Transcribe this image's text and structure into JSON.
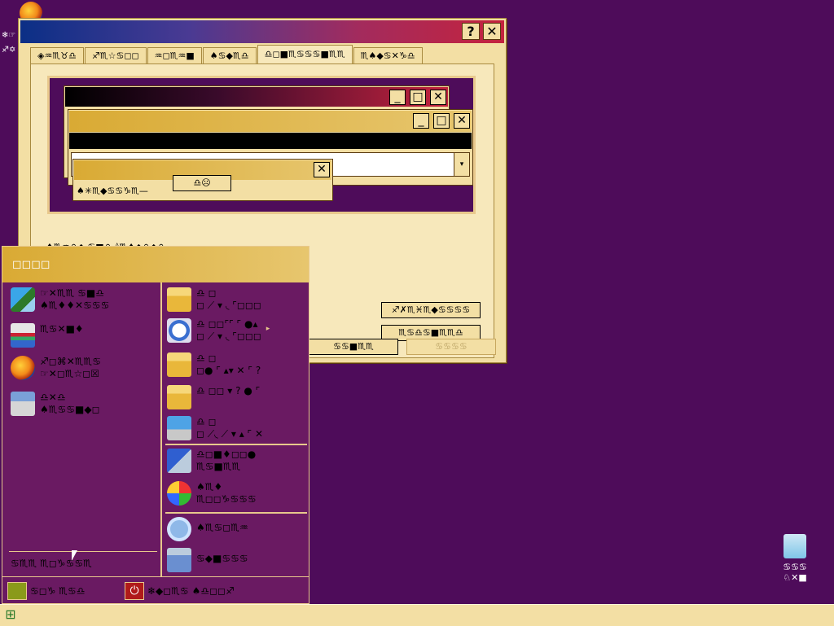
{
  "desktop": {
    "icons": [
      {
        "label": "❄☞"
      },
      {
        "label": "♐✡"
      }
    ],
    "recycle_bin": {
      "label_line1": "♋♋♋",
      "label_line2": "♘✕■"
    }
  },
  "dialog": {
    "help_glyph": "?",
    "close_glyph": "✕",
    "tabs": [
      "◈♒♏♉♎",
      "♐♏☆♋◻◻",
      "♒◻♏♒■",
      "♠♋◆♏♎",
      "♎◻■♏♋♋♋■♏♏",
      "♏♠◆♋✕♑♎"
    ],
    "active_tab": 4,
    "preview": {
      "win1_buttons": {
        "min": "_",
        "max": "□",
        "close": "✕"
      },
      "win2_buttons": {
        "min": "_",
        "max": "□",
        "close": "✕"
      },
      "msgbox": {
        "close": "✕",
        "text": "♠✳♏◆♋♋♑♏—",
        "ok_label": "♎☹"
      }
    },
    "scheme_label": "♦♏♒♎◆  ♋■♎  ◊♏♠◆♎◆♎",
    "scheme_value": "♦♏♒♎◆ ♋◆♏♋◆♓■♏♎ ♦♎◻♎♏",
    "effects_button": "♐✗♏♓♏◆♋♋♋♋",
    "advanced_button": "♏♋♎♋■♏♏♎",
    "footer_buttons": {
      "ok": "♋♋■♏♏",
      "apply": "♋♋♋♋"
    }
  },
  "start_menu": {
    "user_name": "◻◻◻◻",
    "left_items": [
      {
        "line1": "☞✕♏♏  ♋■♎",
        "line2": "♠♏♦♦✕♋♋♋"
      },
      {
        "line1": "♏♋✕■♦",
        "line2": ""
      },
      {
        "line1": "♐◻⌘✕♏♏♋",
        "line2": "☞✕◻♏☆◻☒"
      },
      {
        "line1": "♎✕♎",
        "line2": "♠♏♋♋■◆◻"
      }
    ],
    "all_programs": "♋♏♏  ♏◻♑♋♋♏",
    "right_items": [
      {
        "line1": "♎ ◻",
        "line2": "◻ ⟋ ▾ ◟ ⌜◻◻◻"
      },
      {
        "line1": "♎ ◻◻⌜⌜ ⌜ ●▴",
        "line2": "◻ ⟋ ▾ ◟ ⌜◻◻◻"
      },
      {
        "line1": "♎ ◻",
        "line2": "◻● ⌜ ▴▾ ✕ ⌜ ?"
      },
      {
        "line1": "♎ ◻◻ ▾ ? ● ⌜",
        "line2": ""
      },
      {
        "line1": "♎ ◻",
        "line2": "◻ ⟋◟ ⟋ ▾ ▴ ⌜ ✕"
      },
      {
        "line1": "♎◻■♦◻◻●",
        "line2": "♏♋■♏♏"
      },
      {
        "line1": "♠♏♦",
        "line2": "♏◻◻♑♋♋♋"
      },
      {
        "line1": "♠♏♋◻♏♒",
        "line2": ""
      },
      {
        "line1": "♋◆■♋♋♋",
        "line2": ""
      }
    ],
    "footer": {
      "logoff_label": "♋◻♑  ♏♋♎",
      "shutdown_label": "❄◆◻♏♋  ♠♎◻◻♐"
    }
  },
  "taskbar": {
    "start_glyph": "⊞"
  }
}
